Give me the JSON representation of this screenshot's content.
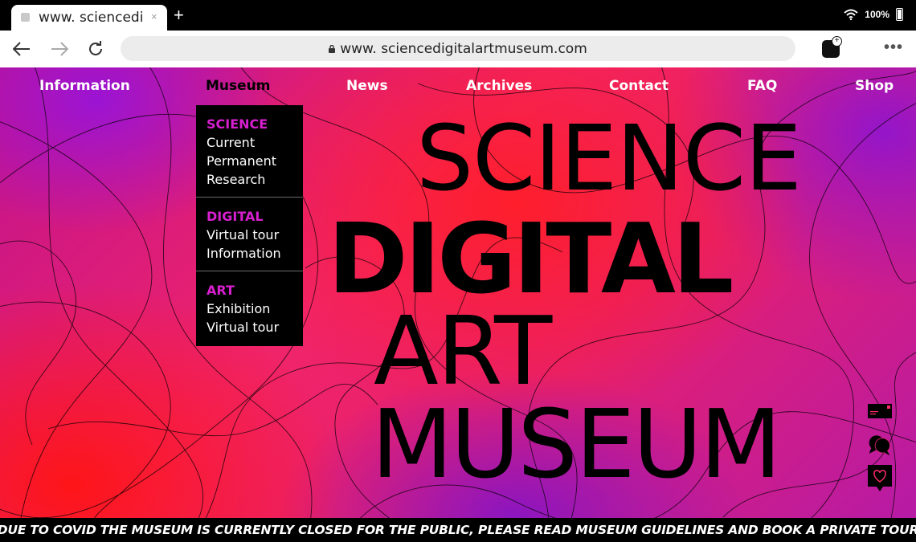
{
  "browser": {
    "tab_title": "www. sciencedi",
    "tab_close": "×",
    "new_tab": "+",
    "battery_percent": "100%",
    "url": "www. sciencedigitalartmuseum.com"
  },
  "nav": {
    "items": [
      {
        "label": "Information"
      },
      {
        "label": "Museum",
        "active": true
      },
      {
        "label": "News"
      },
      {
        "label": "Archives"
      },
      {
        "label": "Contact"
      },
      {
        "label": "FAQ"
      },
      {
        "label": "Shop"
      }
    ]
  },
  "dropdown": {
    "groups": [
      {
        "heading": "SCIENCE",
        "items": [
          "Current",
          "Permanent",
          "Research"
        ]
      },
      {
        "heading": "DIGITAL",
        "items": [
          "Virtual tour",
          "Information"
        ]
      },
      {
        "heading": "ART",
        "items": [
          "Exhibition",
          "Virtual tour"
        ]
      }
    ]
  },
  "hero": {
    "line1": "SCIENCE",
    "line2": "DIGITAL",
    "line3": "ART",
    "line4": "MUSEUM"
  },
  "side_icons": [
    "mail-icon",
    "chat-icon",
    "heart-icon"
  ],
  "banner": {
    "text": "*DUE TO COVID THE MUSEUM IS CURRENTLY CLOSED FOR THE PUBLIC, PLEASE READ MUSEUM GUIDELINES AND BOOK A PRIVATE TOUR*"
  },
  "colors": {
    "accent_magenta": "#d81fcf",
    "gradient_red": "#ff1e1e",
    "gradient_pink": "#f0246a",
    "gradient_purple": "#8c14d2"
  }
}
